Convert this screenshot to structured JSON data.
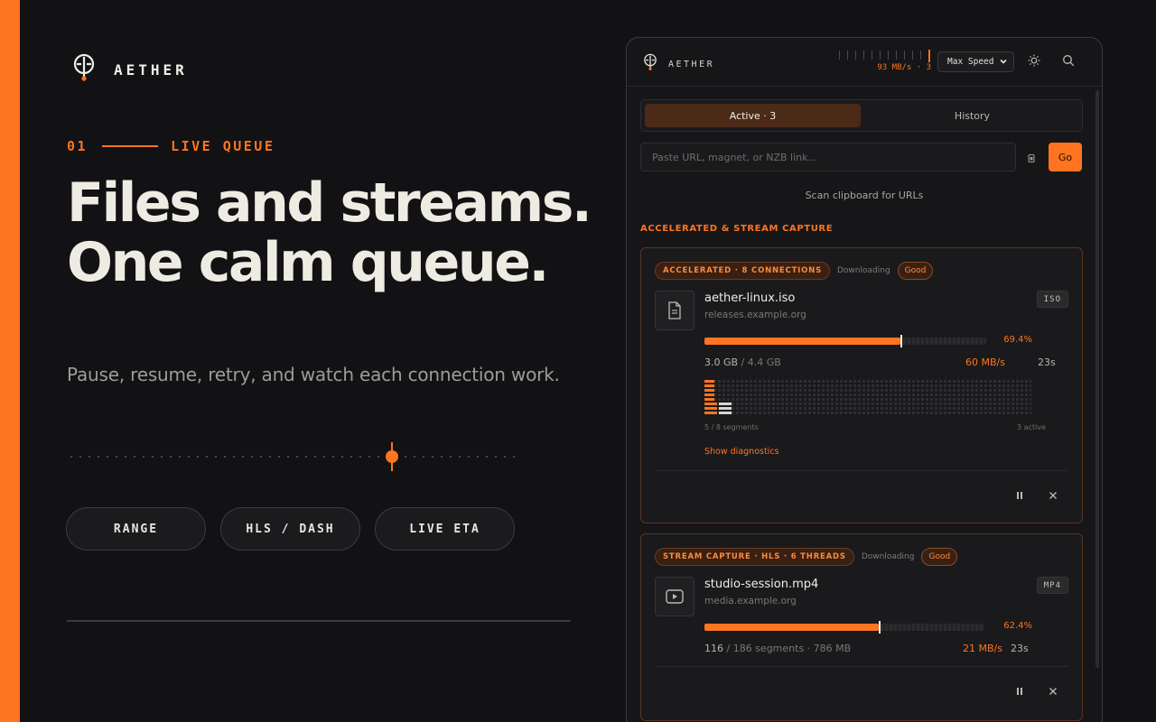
{
  "brand": {
    "name": "AETHER"
  },
  "hero": {
    "eyebrow_number": "01",
    "eyebrow_label": "LIVE QUEUE",
    "headline_line1": "Files and streams.",
    "headline_line2": "One calm queue.",
    "subline": "Pause, resume, retry, and watch each connection work.",
    "pills": [
      "RANGE",
      "HLS / DASH",
      "LIVE ETA"
    ],
    "slider_level": 0.72
  },
  "app": {
    "logo_text": "AETHER",
    "meter_readout": "93 MB/s · 3",
    "speed_mode": "Max Speed",
    "tabs": {
      "active": "Active · 3",
      "history": "History"
    },
    "url_placeholder": "Paste URL, magnet, or NZB link...",
    "go_label": "Go",
    "scan_label": "Scan clipboard for URLs",
    "section_title": "ACCELERATED & STREAM CAPTURE",
    "colors": {
      "accent": "#ff7420",
      "background": "#121214",
      "panel": "#161618"
    },
    "downloads": [
      {
        "type_badge": "ACCELERATED · 8 CONNECTIONS",
        "status": "Downloading",
        "health": "Good",
        "icon": "file-icon",
        "name": "aether-linux.iso",
        "host": "releases.example.org",
        "ext": "ISO",
        "progress": 0.694,
        "pct_label": "69.4%",
        "done": "3.0 GB",
        "total": " / 4.4 GB",
        "rate": "60 MB/s",
        "eta": "23s",
        "segments_label": "5 / 8 segments",
        "active_label": "3 active",
        "diagnostics_label": "Show diagnostics",
        "segment_fill": [
          0.03,
          0.03,
          0.03,
          0.03,
          0.03,
          0.04,
          0.04,
          0.04
        ]
      },
      {
        "type_badge": "STREAM CAPTURE · HLS · 6 THREADS",
        "status": "Downloading",
        "health": "Good",
        "icon": "play-icon",
        "name": "studio-session.mp4",
        "host": "media.example.org",
        "ext": "MP4",
        "progress": 0.624,
        "pct_label": "62.4%",
        "done": "116",
        "total": " / 186 segments · 786 MB",
        "rate": "21 MB/s",
        "eta": "23s"
      }
    ]
  }
}
